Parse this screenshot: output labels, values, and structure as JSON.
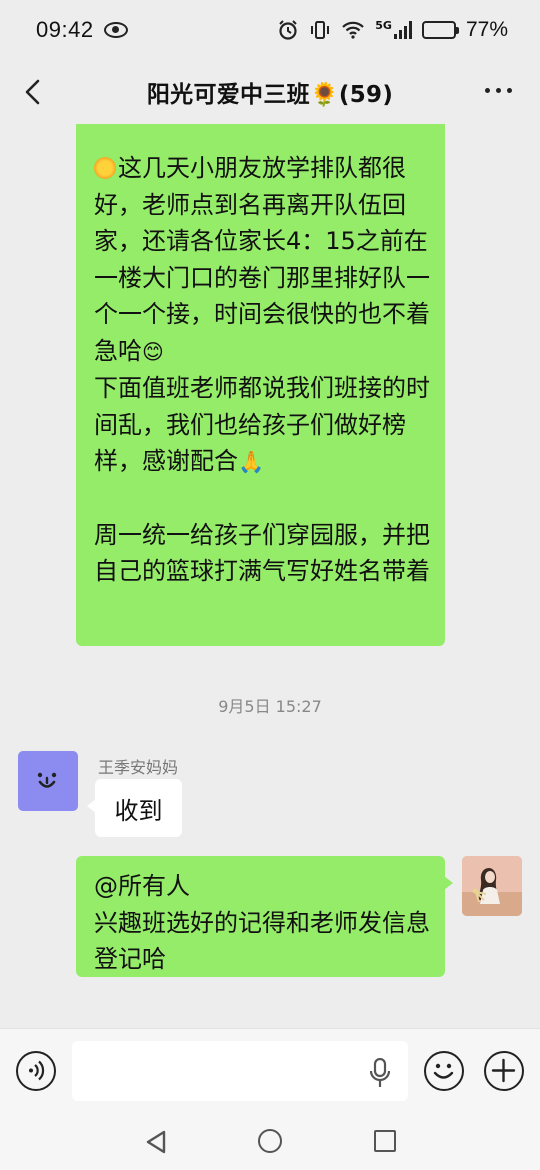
{
  "status_bar": {
    "time": "09:42",
    "network_label": "5G",
    "battery_level": 0.77,
    "battery_text": "77%"
  },
  "header": {
    "title": "阳光可爱中三班🌻(59)",
    "back_icon": "chevron-left-icon",
    "more_icon": "more-dots-icon"
  },
  "messages": {
    "m1": {
      "para1_lead_icon": "sun-emoji",
      "para1": "这几天小朋友放学排队都很好，老师点到名再离开队伍回家，还请各位家长4：15之前在一楼大门口的卷门那里排好队一个一个接，时间会很快的也不着急哈",
      "para1_emoji": "😊",
      "para2": "下面值班老师都说我们班接的时间乱，我们也给孩子们做好榜样，感谢配合",
      "para2_emoji": "🙏",
      "para3": "周一统一给孩子们穿园服，并把自己的篮球打满气写好姓名带着"
    },
    "timestamp": "9月5日 15:27",
    "m2": {
      "sender": "王季安妈妈",
      "text": "收到"
    },
    "m3": {
      "line1": "@所有人",
      "line2": "兴趣班选好的记得和老师发信息登记哈"
    }
  },
  "input_bar": {
    "voice_icon": "voice-icon",
    "mic_icon": "microphone-icon",
    "emoji_icon": "smiley-icon",
    "plus_icon": "plus-icon"
  },
  "nav_bar": {
    "back_icon": "triangle-back-icon",
    "home_icon": "circle-home-icon",
    "recents_icon": "square-recents-icon"
  },
  "colors": {
    "bubble_self": "#95ec69",
    "bubble_other": "#ffffff",
    "background": "#ededed",
    "avatar_other": "#8b8bf0"
  }
}
